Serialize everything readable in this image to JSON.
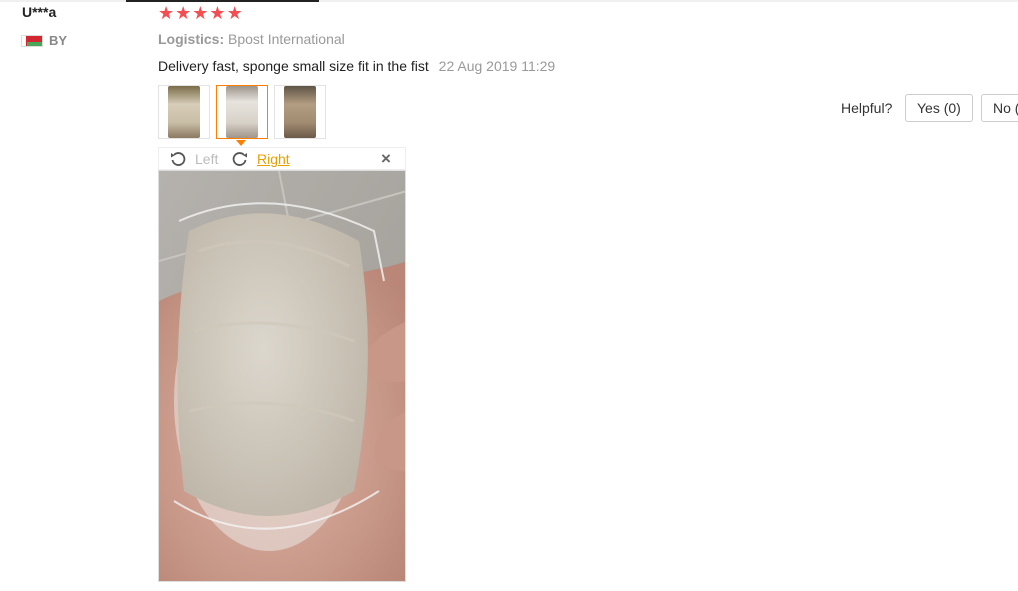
{
  "review": {
    "user_name": "U***a",
    "country_code": "BY",
    "stars": [
      "★",
      "★",
      "★",
      "★",
      "★"
    ],
    "logistics_label": "Logistics:",
    "logistics_value": "Bpost International",
    "text": "Delivery fast, sponge small size fit in the fist",
    "date": "22 Aug 2019 11:29"
  },
  "thumbnails": [
    {
      "name": "review-photo-1"
    },
    {
      "name": "review-photo-2",
      "active": true
    },
    {
      "name": "review-photo-3"
    }
  ],
  "viewer": {
    "rotate_left_label": "Left",
    "rotate_right_label": "Right",
    "close_icon": "×"
  },
  "helpful": {
    "label": "Helpful?",
    "yes_label": "Yes (0)",
    "no_label": "No ("
  },
  "colors": {
    "star": "#f44d52",
    "active_border": "#ff7e00",
    "link": "#e8a000"
  }
}
